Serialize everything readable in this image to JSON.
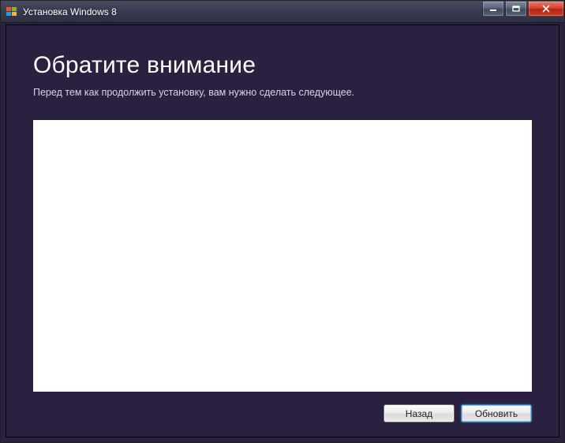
{
  "titlebar": {
    "title": "Установка Windows 8"
  },
  "page": {
    "heading": "Обратите внимание",
    "subtext": "Перед тем как продолжить установку, вам нужно сделать следующее."
  },
  "buttons": {
    "back": "Назад",
    "refresh": "Обновить"
  }
}
